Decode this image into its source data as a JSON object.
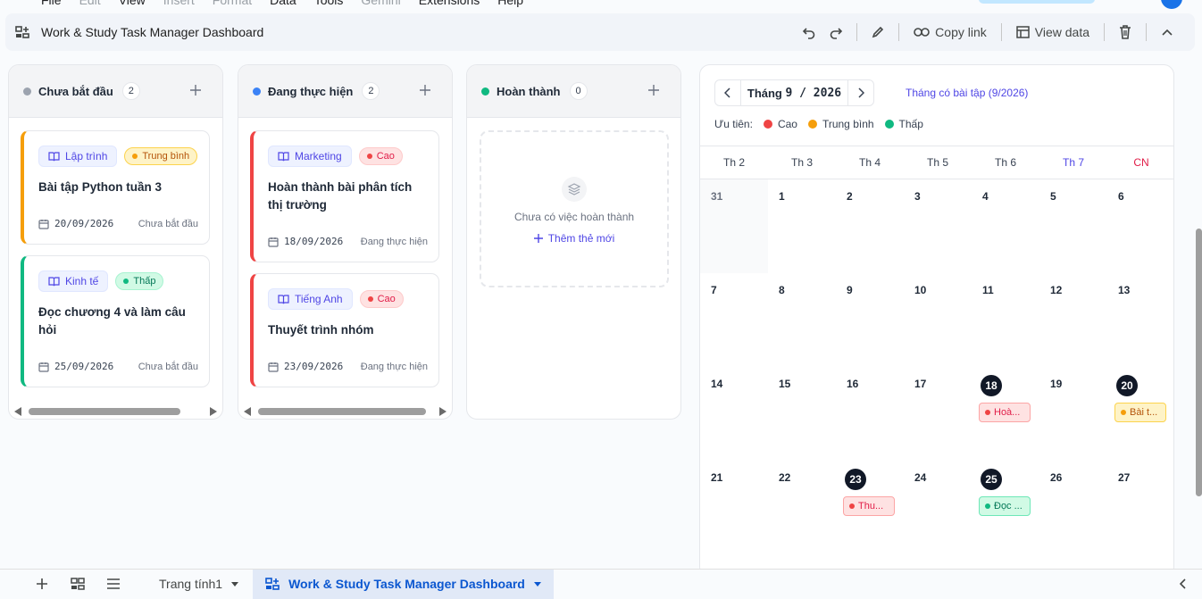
{
  "menu": [
    "File",
    "Edit",
    "View",
    "Insert",
    "Format",
    "Data",
    "Tools",
    "Gemini",
    "Extensions",
    "Help"
  ],
  "header": {
    "title": "Work & Study Task Manager Dashboard",
    "copy_link": "Copy link",
    "view_data": "View data"
  },
  "columns": [
    {
      "name": "Chưa bắt đầu",
      "count": "2",
      "color": "#9ca3af"
    },
    {
      "name": "Đang thực hiện",
      "count": "2",
      "color": "#3b82f6"
    },
    {
      "name": "Hoàn thành",
      "count": "0",
      "color": "#10b981"
    }
  ],
  "cards": [
    {
      "category": "Lập trình",
      "priority": "Trung bình",
      "title": "Bài tập Python tuần 3",
      "date": "20/09/2026",
      "status": "Chưa bắt đầu"
    },
    {
      "category": "Kinh tế",
      "priority": "Thấp",
      "title": "Đọc chương 4 và làm câu hỏi",
      "date": "25/09/2026",
      "status": "Chưa bắt đầu"
    },
    {
      "category": "Marketing",
      "priority": "Cao",
      "title": "Hoàn thành bài phân tích thị trường",
      "date": "18/09/2026",
      "status": "Đang thực hiện"
    },
    {
      "category": "Tiếng Anh",
      "priority": "Cao",
      "title": "Thuyết trình nhóm",
      "date": "23/09/2026",
      "status": "Đang thực hiện"
    }
  ],
  "empty_column": {
    "text": "Chưa có việc hoàn thành",
    "add": "Thêm thẻ mới"
  },
  "calendar": {
    "month_label": "Tháng",
    "month_value": "9 / 2026",
    "subtitle": "Tháng có bài tập (9/2026)",
    "legend_label": "Ưu tiên:",
    "legend": [
      {
        "name": "Cao",
        "color": "#ef4444"
      },
      {
        "name": "Trung bình",
        "color": "#f59e0b"
      },
      {
        "name": "Thấp",
        "color": "#10b981"
      }
    ],
    "weekdays": [
      "Th 2",
      "Th 3",
      "Th 4",
      "Th 5",
      "Th 6",
      "Th 7",
      "CN"
    ],
    "weeks": [
      [
        "31",
        "1",
        "2",
        "3",
        "4",
        "5",
        "6"
      ],
      [
        "7",
        "8",
        "9",
        "10",
        "11",
        "12",
        "13"
      ],
      [
        "14",
        "15",
        "16",
        "17",
        "18",
        "19",
        "20"
      ],
      [
        "21",
        "22",
        "23",
        "24",
        "25",
        "26",
        "27"
      ]
    ],
    "events": [
      {
        "week": 2,
        "day": 4,
        "label": "Hoà...",
        "priority": "Cao"
      },
      {
        "week": 2,
        "day": 6,
        "label": "Bài t...",
        "priority": "Trung bình"
      },
      {
        "week": 3,
        "day": 2,
        "label": "Thu...",
        "priority": "Cao"
      },
      {
        "week": 3,
        "day": 4,
        "label": "Đọc ...",
        "priority": "Thấp"
      }
    ]
  },
  "sheets": [
    {
      "name": "Trang tính1",
      "active": false
    },
    {
      "name": "Work & Study Task Manager Dashboard",
      "active": true
    }
  ],
  "colors": {
    "cao_bg": "#fee2e2",
    "cao_fg": "#e11d48",
    "tb_bg": "#fef3c7",
    "tb_fg": "#b45309",
    "thap_bg": "#d1fae5",
    "thap_fg": "#047857",
    "accent": "#4f46e5"
  }
}
